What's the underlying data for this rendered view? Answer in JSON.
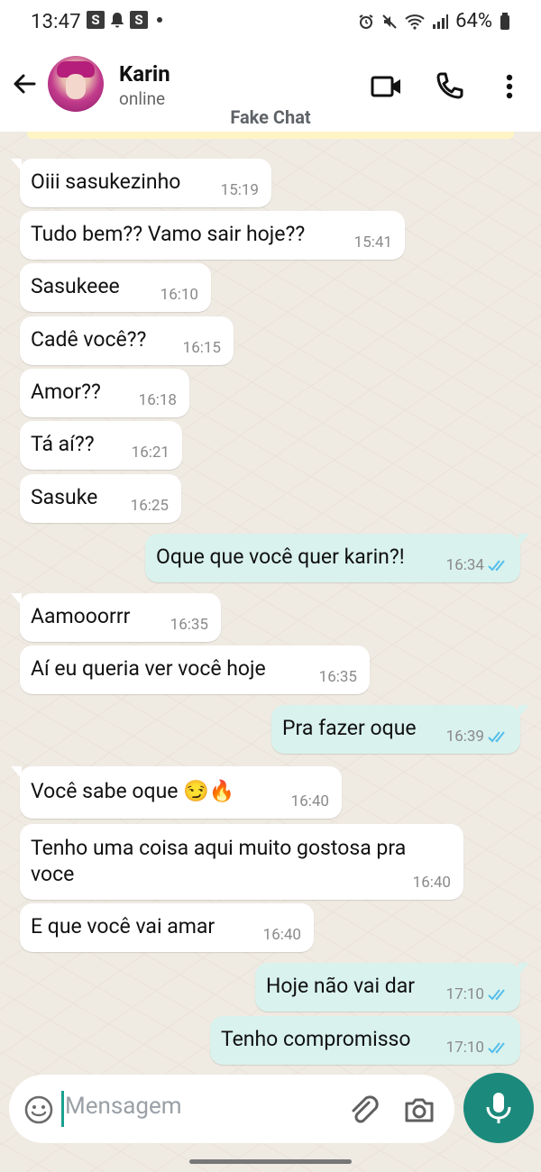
{
  "status_bar": {
    "time": "13:47",
    "notif_a": "S",
    "notif_b": "S",
    "battery": "64%"
  },
  "header": {
    "contact_name": "Karin",
    "contact_status": "online",
    "watermark": "Fake Chat"
  },
  "messages": [
    {
      "dir": "in",
      "text": "Oiii sasukezinho",
      "time": "15:19"
    },
    {
      "dir": "in",
      "text": "Tudo bem?? Vamo sair hoje??",
      "time": "15:41"
    },
    {
      "dir": "in",
      "text": "Sasukeee",
      "time": "16:10"
    },
    {
      "dir": "in",
      "text": "Cadê você??",
      "time": "16:15"
    },
    {
      "dir": "in",
      "text": "Amor??",
      "time": "16:18"
    },
    {
      "dir": "in",
      "text": "Tá aí??",
      "time": "16:21"
    },
    {
      "dir": "in",
      "text": "Sasuke",
      "time": "16:25"
    },
    {
      "dir": "out",
      "text": "Oque que você quer karin?!",
      "time": "16:34"
    },
    {
      "dir": "in",
      "text": "Aamooorrr",
      "time": "16:35"
    },
    {
      "dir": "in",
      "text": "Aí eu queria ver você hoje",
      "time": "16:35"
    },
    {
      "dir": "out",
      "text": "Pra fazer oque",
      "time": "16:39"
    },
    {
      "dir": "in",
      "text": "Você sabe oque 😏🔥",
      "time": "16:40"
    },
    {
      "dir": "in",
      "text": "Tenho uma coisa aqui muito gostosa pra voce",
      "time": "16:40"
    },
    {
      "dir": "in",
      "text": "E que você vai amar",
      "time": "16:40"
    },
    {
      "dir": "out",
      "text": "Hoje não vai dar",
      "time": "17:10"
    },
    {
      "dir": "out",
      "text": "Tenho compromisso",
      "time": "17:10"
    }
  ],
  "composer": {
    "placeholder": "Mensagem"
  },
  "icons": {
    "back": "arrow-left-icon",
    "video": "video-call-icon",
    "phone": "phone-icon",
    "menu": "more-vert-icon",
    "emoji": "emoji-icon",
    "attach": "paperclip-icon",
    "camera": "camera-icon",
    "mic": "mic-icon"
  },
  "colors": {
    "chat_background": "#efeae2",
    "incoming_bubble": "#ffffff",
    "outgoing_bubble": "#d9f2ed",
    "read_ticks": "#53bdeb",
    "mic_button": "#1b8a7c"
  }
}
